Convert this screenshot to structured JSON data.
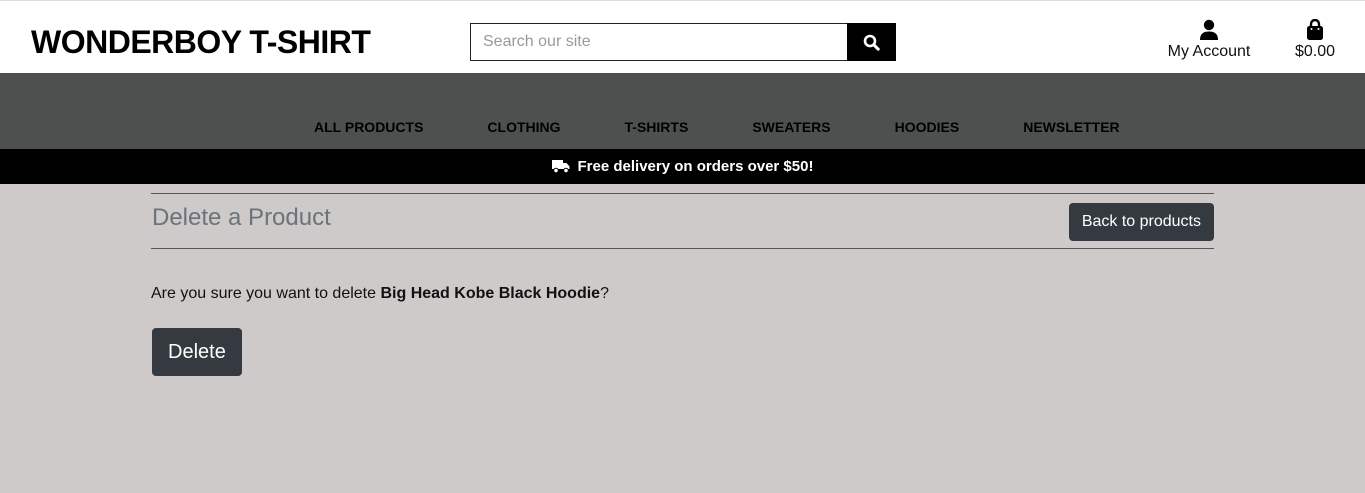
{
  "header": {
    "brand": "WONDERBOY T-SHIRT",
    "search_placeholder": "Search our site",
    "account_label": "My Account",
    "cart_total": "$0.00"
  },
  "nav": {
    "items": [
      {
        "label": "ALL PRODUCTS"
      },
      {
        "label": "CLOTHING"
      },
      {
        "label": "T-SHIRTS"
      },
      {
        "label": "SWEATERS"
      },
      {
        "label": "HOODIES"
      },
      {
        "label": "NEWSLETTER"
      }
    ]
  },
  "banner": {
    "text": "Free delivery on orders over $50!",
    "icon": "truck-icon"
  },
  "page": {
    "title": "Delete a Product",
    "back_button": "Back to products",
    "confirm_prefix": "Are you sure you want to delete ",
    "product_name": "Big Head Kobe Black Hoodie",
    "confirm_suffix": "?",
    "delete_button": "Delete"
  },
  "colors": {
    "background": "#cecac9",
    "nav_background": "#4e504f",
    "banner_background": "#000000",
    "button_background": "#353a40",
    "title_color": "#6b737b"
  }
}
